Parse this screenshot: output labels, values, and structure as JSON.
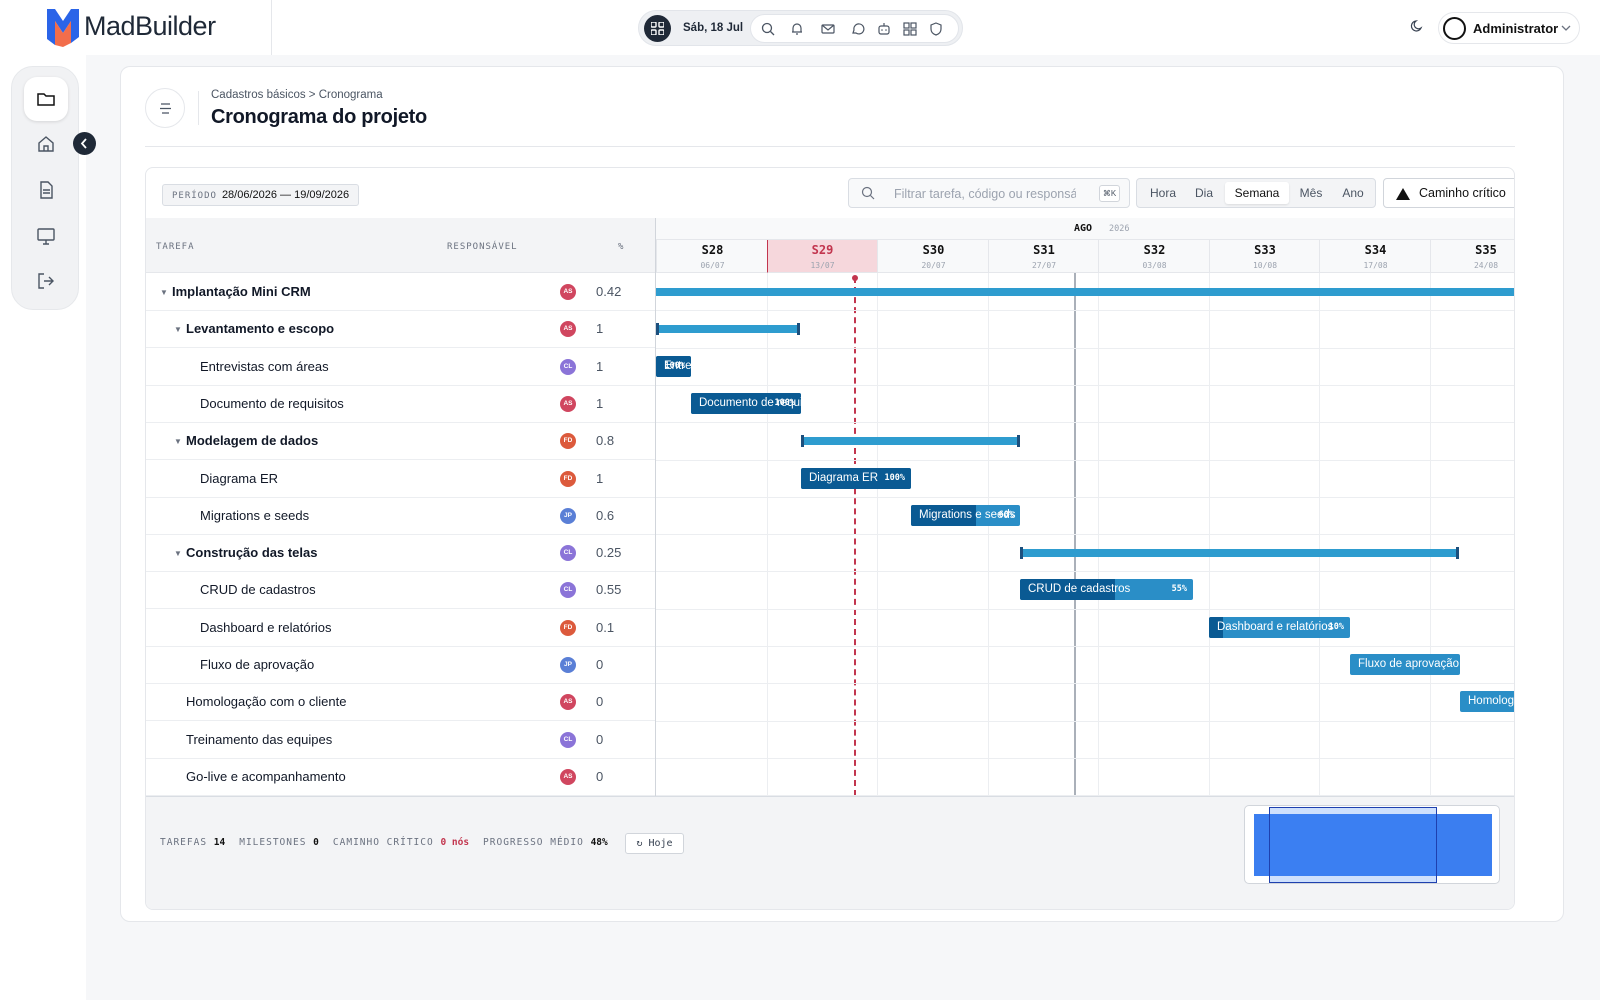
{
  "app": {
    "name": "MadBuilder"
  },
  "topbar": {
    "date": "Sáb, 18 Jul",
    "user": "Administrator",
    "icons": [
      "search-icon",
      "bell-icon",
      "mail-icon",
      "chat-icon",
      "robot-icon",
      "grid-icon",
      "shield-icon"
    ]
  },
  "sidebar": {
    "items": [
      "folder-icon",
      "home-icon",
      "document-icon",
      "monitor-icon",
      "logout-icon"
    ]
  },
  "page": {
    "breadcrumb": "Cadastros básicos > Cronograma",
    "title": "Cronograma do projeto"
  },
  "toolbar": {
    "period_label": "PERÍODO",
    "period_value": "28/06/2026 — 19/09/2026",
    "search_placeholder": "Filtrar tarefa, código ou responsável",
    "search_kbd": "⌘K",
    "scales": [
      "Hora",
      "Dia",
      "Semana",
      "Mês",
      "Ano"
    ],
    "active_scale": "Semana",
    "critical_path": "Caminho crítico"
  },
  "columns": {
    "task": "TAREFA",
    "owner": "RESPONSÁVEL",
    "pct": "%"
  },
  "timeline": {
    "month": "AGO",
    "year": "2026",
    "weeks": [
      {
        "w": "S28",
        "d": "06/07"
      },
      {
        "w": "S29",
        "d": "13/07"
      },
      {
        "w": "S30",
        "d": "20/07"
      },
      {
        "w": "S31",
        "d": "27/07"
      },
      {
        "w": "S32",
        "d": "03/08"
      },
      {
        "w": "S33",
        "d": "10/08"
      },
      {
        "w": "S34",
        "d": "17/08"
      },
      {
        "w": "S35",
        "d": "24/08"
      }
    ],
    "current_week": "S29"
  },
  "tasks": [
    {
      "name": "Implantação Mini CRM",
      "level": 0,
      "group": true,
      "owner": "AS",
      "pct": "0.42"
    },
    {
      "name": "Levantamento e escopo",
      "level": 1,
      "group": true,
      "owner": "AS",
      "pct": "1"
    },
    {
      "name": "Entrevistas com áreas",
      "level": 2,
      "group": false,
      "owner": "CL",
      "pct": "1",
      "bar_label": "Entrevistas com áreas",
      "bar_pct": "100%"
    },
    {
      "name": "Documento de requisitos",
      "level": 2,
      "group": false,
      "owner": "AS",
      "pct": "1",
      "bar_label": "Documento de requisitos",
      "bar_pct": "100%"
    },
    {
      "name": "Modelagem de dados",
      "level": 1,
      "group": true,
      "owner": "FD",
      "pct": "0.8"
    },
    {
      "name": "Diagrama ER",
      "level": 2,
      "group": false,
      "owner": "FD",
      "pct": "1",
      "bar_label": "Diagrama ER",
      "bar_pct": "100%"
    },
    {
      "name": "Migrations e seeds",
      "level": 2,
      "group": false,
      "owner": "JP",
      "pct": "0.6",
      "bar_label": "Migrations e seeds",
      "bar_pct": "60%"
    },
    {
      "name": "Construção das telas",
      "level": 1,
      "group": true,
      "owner": "CL",
      "pct": "0.25"
    },
    {
      "name": "CRUD de cadastros",
      "level": 2,
      "group": false,
      "owner": "CL",
      "pct": "0.55",
      "bar_label": "CRUD de cadastros",
      "bar_pct": "55%"
    },
    {
      "name": "Dashboard e relatórios",
      "level": 2,
      "group": false,
      "owner": "FD",
      "pct": "0.1",
      "bar_label": "Dashboard e relatórios",
      "bar_pct": "10%"
    },
    {
      "name": "Fluxo de aprovação",
      "level": 2,
      "group": false,
      "owner": "JP",
      "pct": "0",
      "bar_label": "Fluxo de aprovação",
      "bar_pct": ""
    },
    {
      "name": "Homologação com o cliente",
      "level": 1,
      "group": false,
      "owner": "AS",
      "pct": "0",
      "bar_label": "Homologação com o cliente",
      "bar_pct": ""
    },
    {
      "name": "Treinamento das equipes",
      "level": 1,
      "group": false,
      "owner": "CL",
      "pct": "0"
    },
    {
      "name": "Go-live e acompanhamento",
      "level": 1,
      "group": false,
      "owner": "AS",
      "pct": "0"
    }
  ],
  "owner_colors": {
    "AS": "#d0465f",
    "CL": "#8b74d8",
    "FD": "#dc5a3c",
    "JP": "#5a7fd6"
  },
  "colors": {
    "bar_done": "#0a5a93",
    "bar_todo": "#2a8ec7",
    "summary": "#2e9ccf",
    "today": "#c2354e"
  },
  "footer": {
    "tasks_label": "TAREFAS",
    "tasks": "14",
    "milestones_label": "MILESTONES",
    "milestones": "0",
    "critical_label": "CAMINHO CRÍTICO",
    "critical": "0 nós",
    "progress_label": "PROGRESSO MÉDIO",
    "progress": "48%",
    "today_btn": "↻ Hoje"
  }
}
